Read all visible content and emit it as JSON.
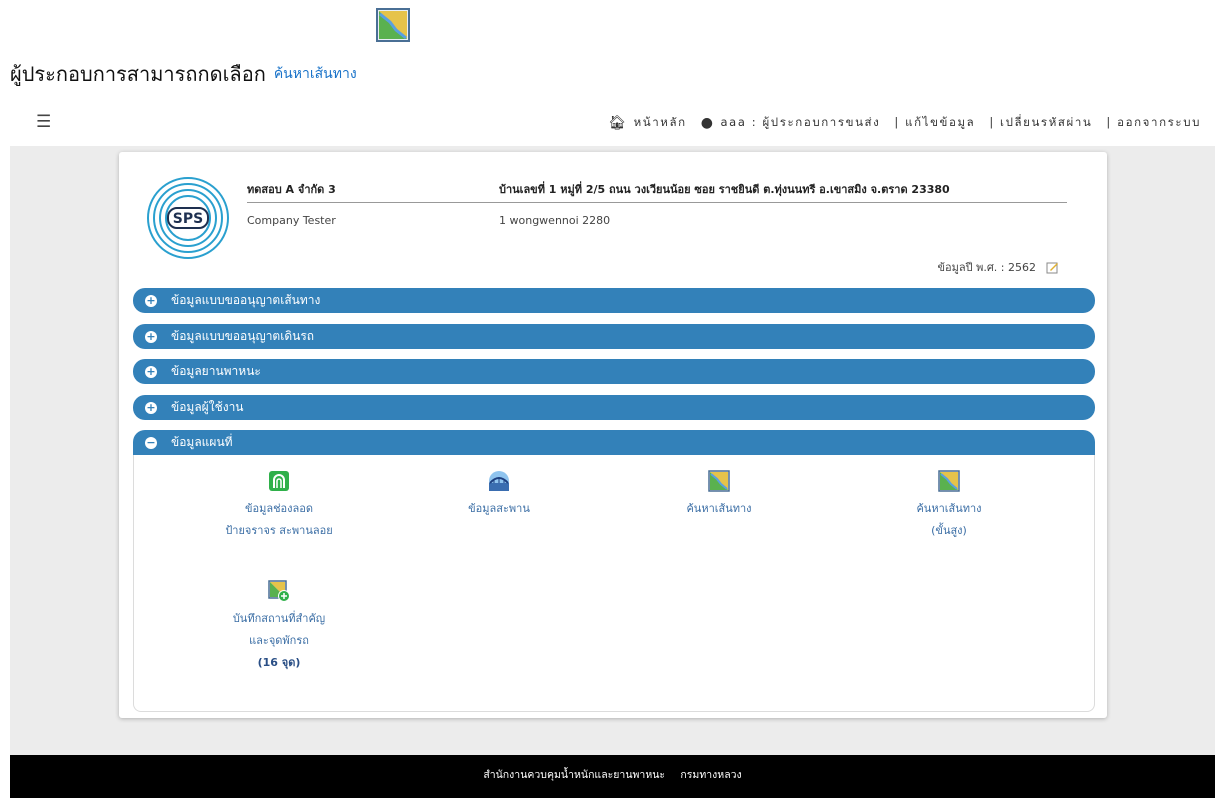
{
  "caption": {
    "text": "ผู้ประกอบการสามารถกดเลือก",
    "link": "ค้นหาเส้นทาง"
  },
  "nav": {
    "home": "หน้าหลัก",
    "user": "aaa : ผู้ประกอบการขนส่ง",
    "edit_profile": "| แก้ไขข้อมูล",
    "change_password": "| เปลี่ยนรหัสผ่าน",
    "logout": "| ออกจากระบบ"
  },
  "company": {
    "name": "ทดสอบ A จำกัด 3",
    "name_en": "Company Tester",
    "address_th": "บ้านเลขที่ 1 หมู่ที่ 2/5 ถนน วงเวียนน้อย ซอย ราชยินดี ต.ทุ่งนนทรี อ.เขาสมิง จ.ตราด 23380",
    "address_en": "1 wongwennoi 2280",
    "year_label": "ข้อมูลปี พ.ศ. : 2562",
    "logo_text": "SPS"
  },
  "accordion": [
    {
      "label": "ข้อมูลแบบขออนุญาตเส้นทาง",
      "sign": "+"
    },
    {
      "label": "ข้อมูลแบบขออนุญาตเดินรถ",
      "sign": "+"
    },
    {
      "label": "ข้อมูลยานพาหนะ",
      "sign": "+"
    },
    {
      "label": "ข้อมูลผู้ใช้งาน",
      "sign": "+"
    },
    {
      "label": "ข้อมูลแผนที่",
      "sign": "−"
    }
  ],
  "map_tiles": [
    {
      "line1": "ข้อมูลช่องลอด",
      "line2": "ป้ายจราจร สะพานลอย",
      "icon": "tunnel-icon"
    },
    {
      "line1": "ข้อมูลสะพาน",
      "icon": "bridge-icon"
    },
    {
      "line1": "ค้นหาเส้นทาง",
      "icon": "map-route-icon"
    },
    {
      "line1": "ค้นหาเส้นทาง",
      "line2": "(ขั้นสูง)",
      "icon": "map-route-advanced-icon"
    },
    {
      "line1": "บันทึกสถานที่สำคัญ",
      "line2": "และจุดพักรถ",
      "line3": "(16 จุด)",
      "icon": "map-add-icon"
    }
  ],
  "footer": {
    "office": "สำนักงานควบคุมน้ำหนักและยานพาหนะ",
    "dept": "กรมทางหลวง"
  },
  "colors": {
    "accent": "#3381b9",
    "link": "#3b6ea5",
    "footer_bg": "#000000"
  }
}
